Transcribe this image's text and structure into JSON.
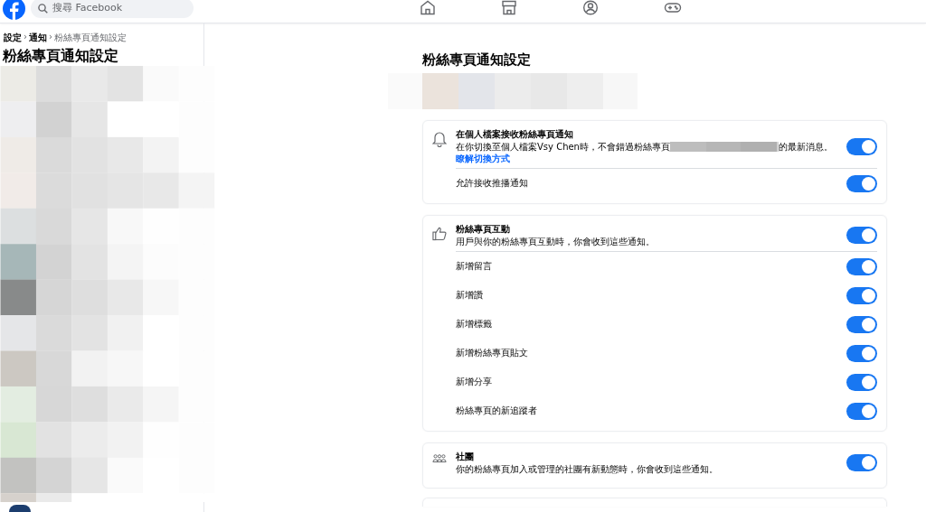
{
  "header": {
    "search": {
      "placeholder": "搜尋 Facebook"
    }
  },
  "sidebar": {
    "breadcrumb": [
      {
        "label": "設定",
        "current": false
      },
      {
        "label": "通知",
        "current": false
      },
      {
        "label": "粉絲專頁通知設定",
        "current": true
      }
    ],
    "separator": "›",
    "title": "粉絲專頁通知設定"
  },
  "main": {
    "title": "粉絲專頁通知設定",
    "sections": [
      {
        "kind": "bell",
        "title": "在個人檔案接收粉絲專頁通知",
        "description": "在你切換至個人檔案Vsy Chen時，不會錯過粉絲專頁",
        "description_after": "的最新消息。",
        "link": "瞭解切換方式",
        "redacted": true,
        "on": true,
        "items": [
          {
            "label": "允許接收推播通知",
            "on": true
          }
        ]
      },
      {
        "kind": "like",
        "title": "粉絲專頁互動",
        "description": "用戶與你的粉絲專頁互動時，你會收到這些通知。",
        "on": true,
        "items": [
          {
            "label": "新增留言",
            "on": true
          },
          {
            "label": "新增讚",
            "on": true
          },
          {
            "label": "新增標籤",
            "on": true
          },
          {
            "label": "新增粉絲專頁貼文",
            "on": true
          },
          {
            "label": "新增分享",
            "on": true
          },
          {
            "label": "粉絲專頁的新追蹤者",
            "on": true
          }
        ]
      },
      {
        "kind": "group",
        "title": "社團",
        "description": "你的粉絲專頁加入或管理的社團有新動態時，你會收到這些通知。",
        "on": true
      }
    ]
  }
}
